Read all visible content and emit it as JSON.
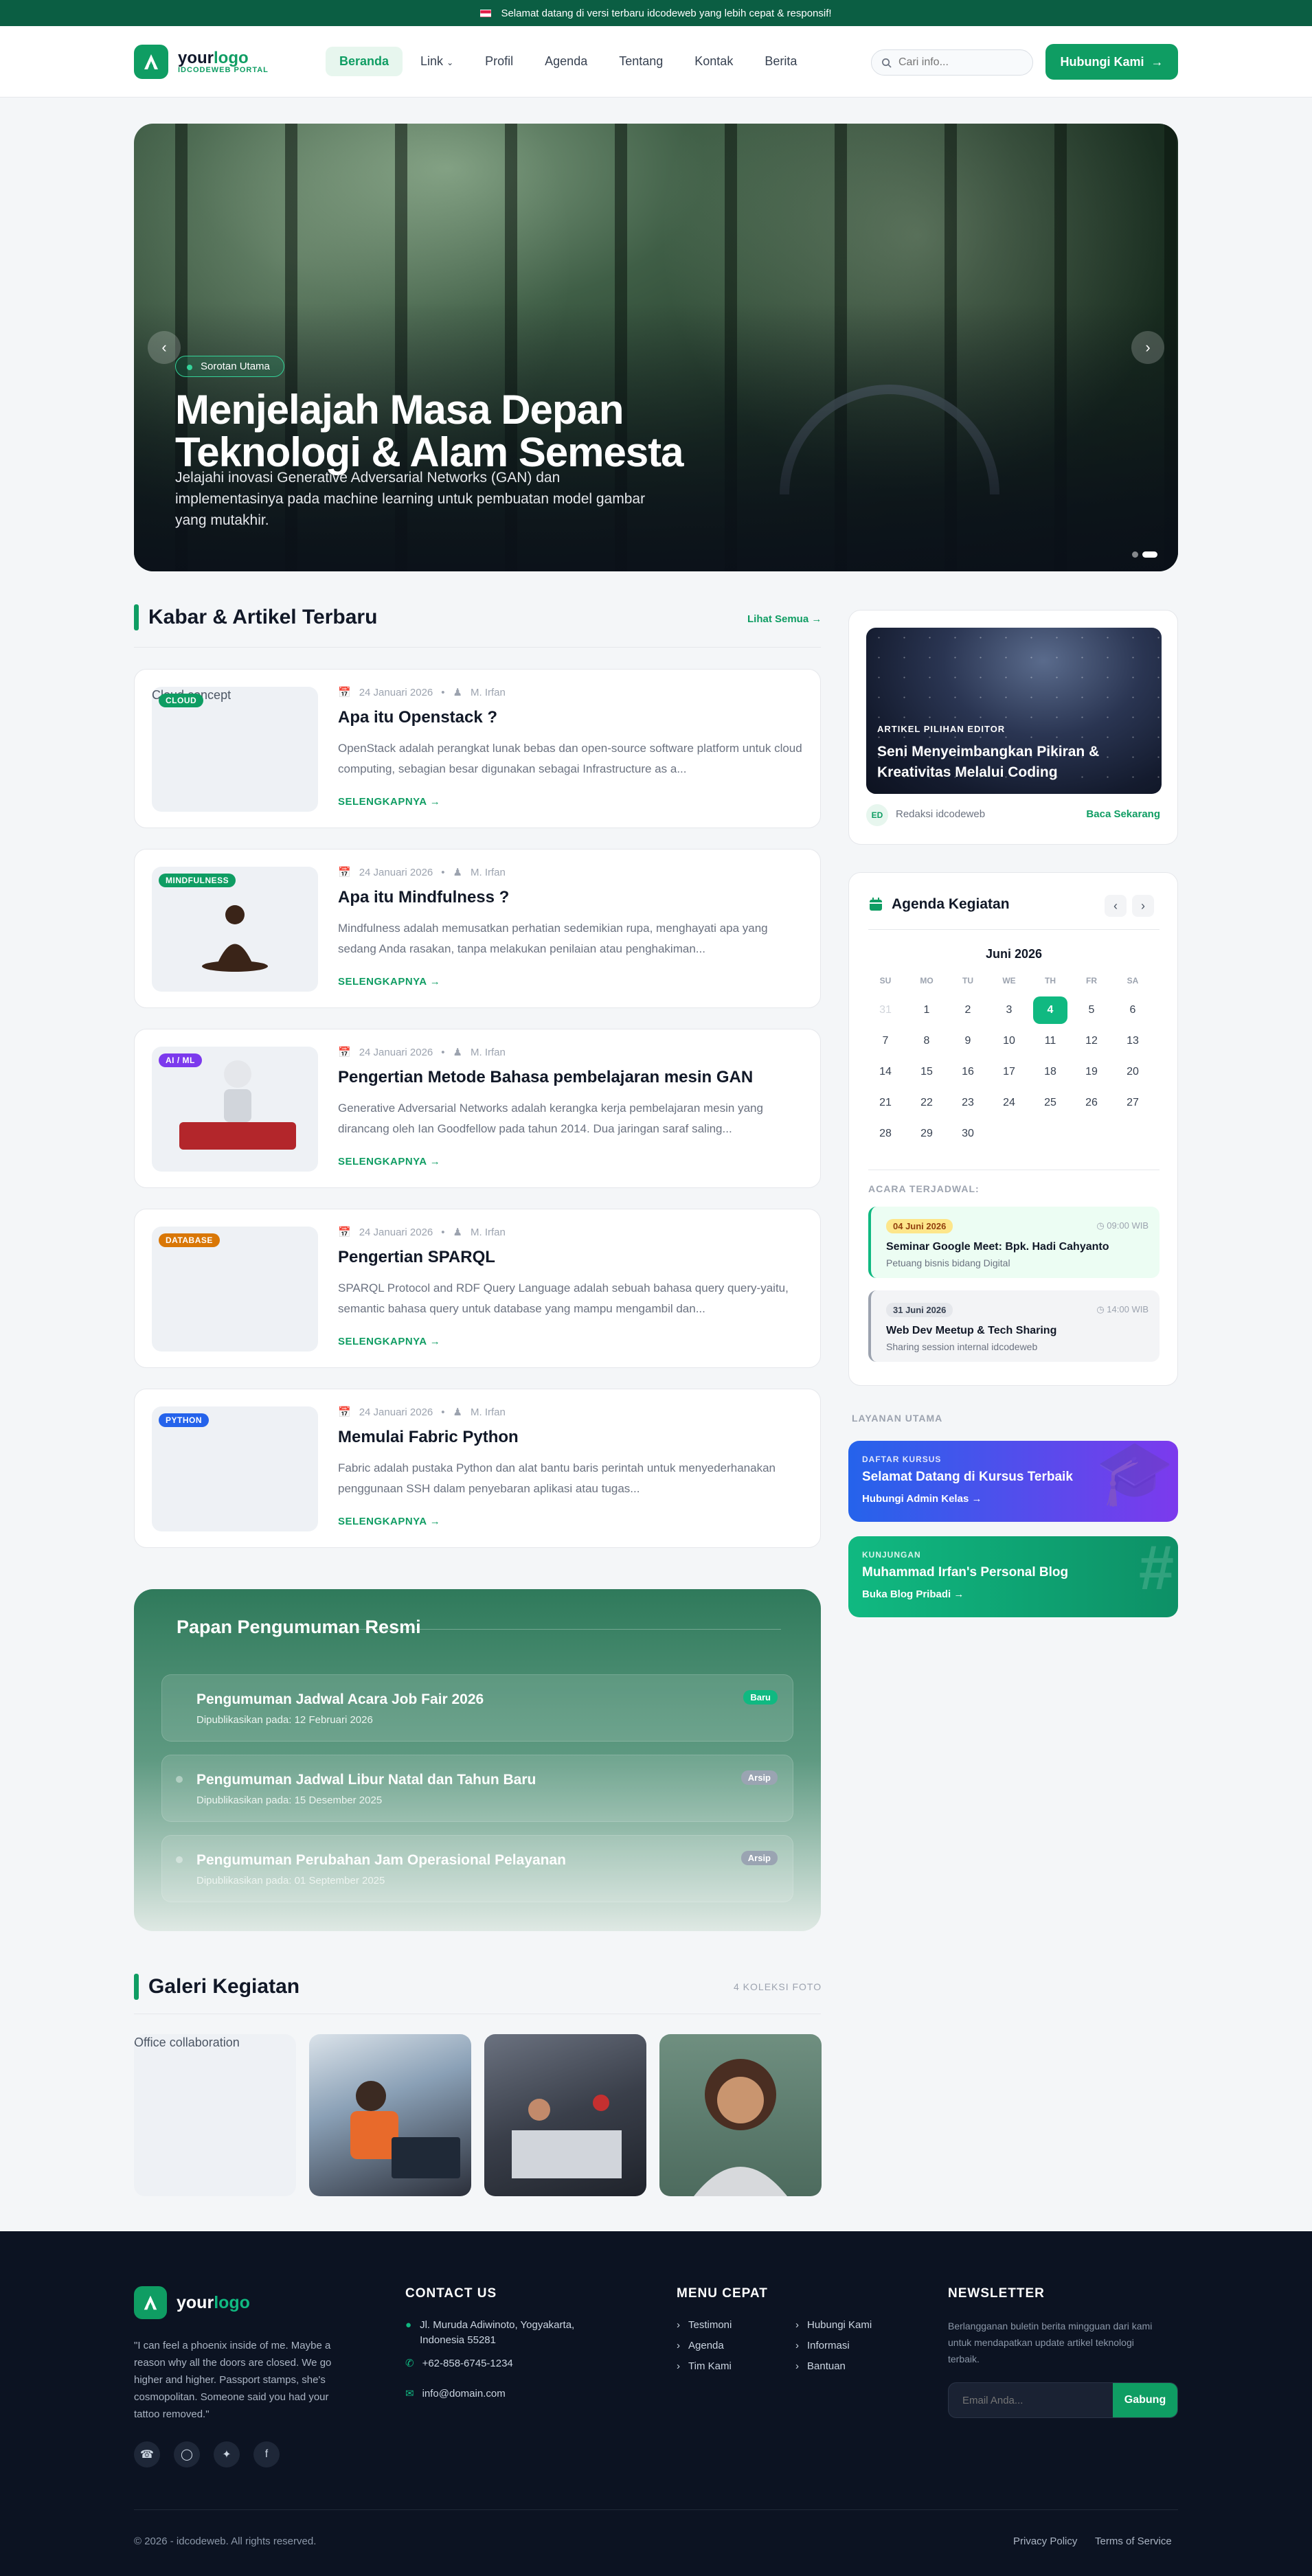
{
  "topbar": {
    "text": "Selamat datang di versi terbaru idcodeweb yang lebih cepat & responsif!"
  },
  "header": {
    "logo_main": "your",
    "logo_accent": "logo",
    "logo_sub": "IDCODEWEB PORTAL",
    "nav": [
      "Beranda",
      "Link",
      "Profil",
      "Agenda",
      "Tentang",
      "Kontak",
      "Berita"
    ],
    "search_placeholder": "Cari info...",
    "cta": "Hubungi Kami"
  },
  "hero": {
    "tag": "Sorotan Utama",
    "title_line1": "Menjelajah Masa Depan",
    "title_line2": "Teknologi & Alam Semesta",
    "desc": "Jelajahi inovasi Generative Adversarial Networks (GAN) dan implementasinya pada machine learning untuk pembuatan model gambar yang mutakhir."
  },
  "news": {
    "title": "Kabar & Artikel Terbaru",
    "see_all": "Lihat Semua",
    "read_more": "SELENGKAPNYA",
    "articles": [
      {
        "alt": "Cloud concept",
        "badge": "CLOUD",
        "date": "24 Januari 2026",
        "author": "M. Irfan",
        "title": "Apa itu Openstack ?",
        "excerpt": "OpenStack adalah perangkat lunak bebas dan open-source software platform untuk cloud computing, sebagian besar digunakan sebagai Infrastructure as a..."
      },
      {
        "alt": "",
        "badge": "MINDFULNESS",
        "date": "24 Januari 2026",
        "author": "M. Irfan",
        "title": "Apa itu Mindfulness ?",
        "excerpt": "Mindfulness adalah memusatkan perhatian sedemikian rupa, menghayati apa yang sedang Anda rasakan, tanpa melakukan penilaian atau penghakiman..."
      },
      {
        "alt": "",
        "badge": "AI / ML",
        "date": "24 Januari 2026",
        "author": "M. Irfan",
        "title": "Pengertian Metode Bahasa pembelajaran mesin GAN",
        "excerpt": "Generative Adversarial Networks adalah kerangka kerja pembelajaran mesin yang dirancang oleh Ian Goodfellow pada tahun 2014. Dua jaringan saraf saling..."
      },
      {
        "alt": "",
        "badge": "DATABASE",
        "date": "24 Januari 2026",
        "author": "M. Irfan",
        "title": "Pengertian SPARQL",
        "excerpt": "SPARQL Protocol and RDF Query Language adalah sebuah bahasa query query-yaitu, semantic bahasa query untuk database yang mampu mengambil dan..."
      },
      {
        "alt": "",
        "badge": "PYTHON",
        "date": "24 Januari 2026",
        "author": "M. Irfan",
        "title": "Memulai Fabric Python",
        "excerpt": "Fabric adalah pustaka Python dan alat bantu baris perintah untuk menyederhanakan penggunaan SSH dalam penyebaran aplikasi atau tugas..."
      }
    ]
  },
  "board": {
    "title": "Papan Pengumuman Resmi",
    "items": [
      {
        "title": "Pengumuman Jadwal Acara Job Fair 2026",
        "date": "Dipublikasikan pada: 12 Februari 2026",
        "status": "Baru"
      },
      {
        "title": "Pengumuman Jadwal Libur Natal dan Tahun Baru",
        "date": "Dipublikasikan pada: 15 Desember 2025",
        "status": "Arsip"
      },
      {
        "title": "Pengumuman Perubahan Jam Operasional Pelayanan",
        "date": "Dipublikasikan pada: 01 September 2025",
        "status": "Arsip"
      }
    ]
  },
  "gallery": {
    "title": "Galeri Kegiatan",
    "count": "4 KOLEKSI FOTO",
    "first_alt": "Office collaboration"
  },
  "featured": {
    "kicker": "ARTIKEL PILIHAN EDITOR",
    "title": "Seni Menyeimbangkan Pikiran & Kreativitas Melalui Coding",
    "avatar": "ED",
    "author": "Redaksi idcodeweb",
    "read": "Baca Sekarang"
  },
  "agenda": {
    "title": "Agenda Kegiatan",
    "month": "Juni 2026",
    "weekdays": [
      "SU",
      "MO",
      "TU",
      "WE",
      "TH",
      "FR",
      "SA"
    ],
    "days": [
      "31",
      "1",
      "2",
      "3",
      "4",
      "5",
      "6",
      "7",
      "8",
      "9",
      "10",
      "11",
      "12",
      "13",
      "14",
      "15",
      "16",
      "17",
      "18",
      "19",
      "20",
      "21",
      "22",
      "23",
      "24",
      "25",
      "26",
      "27",
      "28",
      "29",
      "30"
    ],
    "selected_day": "4",
    "upcoming_label": "ACARA TERJADWAL:",
    "events": [
      {
        "date": "04 Juni 2026",
        "time": "09:00 WIB",
        "title": "Seminar Google Meet: Bpk. Hadi Cahyanto",
        "desc": "Petuang bisnis bidang Digital"
      },
      {
        "date": "31 Juni 2026",
        "time": "14:00 WIB",
        "title": "Web Dev Meetup & Tech Sharing",
        "desc": "Sharing session internal idcodeweb"
      }
    ]
  },
  "services": {
    "label": "LAYANAN UTAMA",
    "items": [
      {
        "kicker": "DAFTAR KURSUS",
        "title": "Selamat Datang di Kursus Terbaik",
        "link": "Hubungi Admin Kelas"
      },
      {
        "kicker": "KUNJUNGAN",
        "title": "Muhammad Irfan's Personal Blog",
        "link": "Buka Blog Pribadi"
      }
    ]
  },
  "footer": {
    "quote": "\"I can feel a phoenix inside of me. Maybe a reason why all the doors are closed. We go higher and higher. Passport stamps, she's cosmopolitan. Someone said you had your tattoo removed.\"",
    "contact_title": "CONTACT US",
    "address": "Jl. Muruda Adiwinoto, Yogyakarta, Indonesia 55281",
    "phone": "+62-858-6745-1234",
    "email": "info@domain.com",
    "menu_title": "MENU CEPAT",
    "menu": [
      "Testimoni",
      "Hubungi Kami",
      "Agenda",
      "Informasi",
      "Tim Kami",
      "Bantuan"
    ],
    "newsletter_title": "NEWSLETTER",
    "newsletter_desc": "Berlangganan buletin berita mingguan dari kami untuk mendapatkan update artikel teknologi terbaik.",
    "newsletter_placeholder": "Email Anda...",
    "newsletter_button": "Gabung",
    "copyright": "© 2026 - idcodeweb. All rights reserved.",
    "privacy": "Privacy Policy",
    "terms": "Terms of Service"
  },
  "colors": {
    "brand": "#0f9d63",
    "dark": "#0c1322",
    "topbar": "#0b5e43"
  }
}
